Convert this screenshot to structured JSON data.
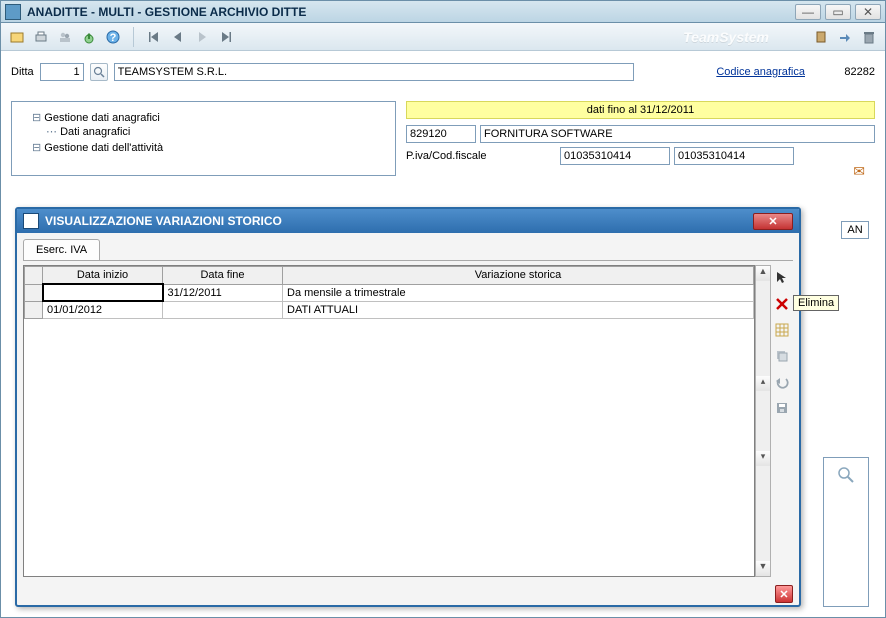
{
  "window": {
    "title": "ANADITTE  - MULTI -  GESTIONE ARCHIVIO DITTE"
  },
  "brand": "TeamSystem",
  "ditta": {
    "label": "Ditta",
    "id": "1",
    "name": "TEAMSYSTEM S.R.L.",
    "codice_link": "Codice anagrafica",
    "codice_val": "82282"
  },
  "tree": {
    "n1": "Gestione dati anagrafici",
    "n1a": "Dati anagrafici",
    "n2": "Gestione dati dell'attività"
  },
  "right": {
    "dati_fino": "dati fino al 31/12/2011",
    "code1": "829120",
    "desc1": "FORNITURA SOFTWARE",
    "piva_label": "P.iva/Cod.fiscale",
    "piva1": "01035310414",
    "piva2": "01035310414",
    "an": "AN"
  },
  "dialog": {
    "title": "VISUALIZZAZIONE VARIAZIONI STORICO",
    "tab": "Eserc. IVA",
    "cols": {
      "rowhdr": "",
      "inizio": "Data inizio",
      "fine": "Data fine",
      "var": "Variazione storica"
    },
    "rows": [
      {
        "inizio": "",
        "fine": "31/12/2011",
        "var": "Da mensile a trimestrale",
        "selected": true
      },
      {
        "inizio": "01/01/2012",
        "fine": "",
        "var": "DATI ATTUALI",
        "selected": false
      }
    ],
    "tooltip": "Elimina"
  }
}
